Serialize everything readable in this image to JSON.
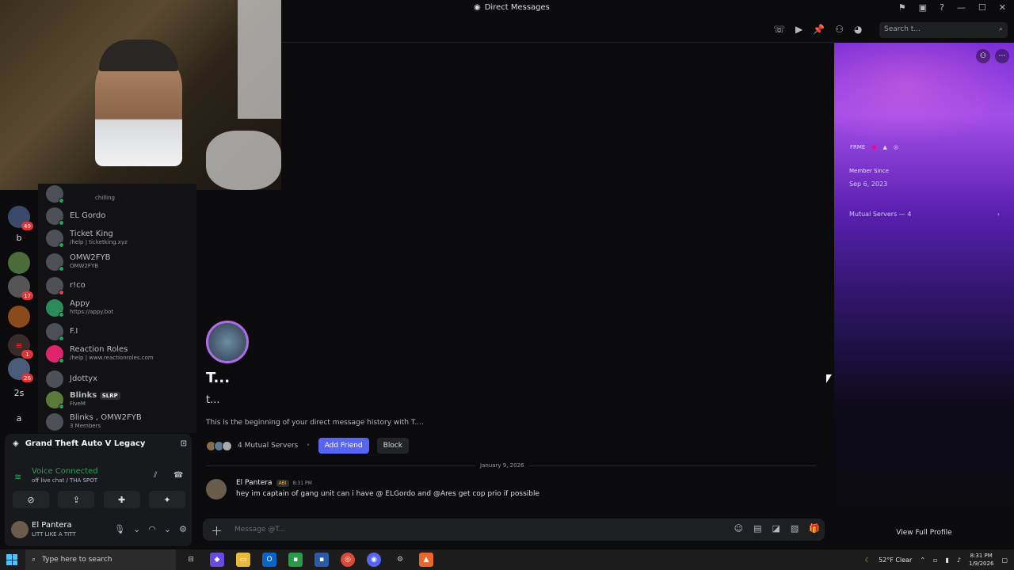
{
  "window": {
    "title": "Direct Messages"
  },
  "header": {
    "search_placeholder": "Search t..."
  },
  "servers": [
    {
      "label": "",
      "badge": "49"
    },
    {
      "label": "b",
      "badge": ""
    },
    {
      "label": "",
      "badge": ""
    },
    {
      "label": "",
      "badge": "17"
    },
    {
      "label": "",
      "badge": ""
    },
    {
      "label": "",
      "badge": "1"
    },
    {
      "label": "",
      "badge": "26"
    },
    {
      "label": "2s",
      "badge": ""
    },
    {
      "label": "a",
      "badge": ""
    }
  ],
  "members": [
    {
      "name": "",
      "sub": "chilling"
    },
    {
      "name": "EL Gordo",
      "sub": ""
    },
    {
      "name": "Ticket King",
      "sub": "/help | ticketking.xyz"
    },
    {
      "name": "OMW2FYB",
      "sub": "OMW2FYB"
    },
    {
      "name": "r!co",
      "sub": ""
    },
    {
      "name": "Appy",
      "sub": "https://appy.bot"
    },
    {
      "name": "F.I",
      "sub": ""
    },
    {
      "name": "Reaction Roles",
      "sub": "/help | www.reactionroles.com"
    },
    {
      "name": "Jdottyx",
      "sub": ""
    },
    {
      "name": "Blinks",
      "sub": "FiveM"
    },
    {
      "name": "Blinks , OMW2FYB",
      "sub": "3 Members"
    }
  ],
  "member_tags": {
    "blinks_tag": "SLRP"
  },
  "voice": {
    "game": "Grand Theft Auto V Legacy",
    "status": "Voice Connected",
    "channel": "off live chat / THA SPOT"
  },
  "user": {
    "name": "El Pantera",
    "status": "LITT LIKE A TITT"
  },
  "dm": {
    "display_name": "T...",
    "username": "t...",
    "beginning": "This is the beginning of your direct message history with T....",
    "mutual_servers": "4 Mutual Servers",
    "add_friend": "Add Friend",
    "block": "Block"
  },
  "messages": {
    "date": "January 9, 2026",
    "items": [
      {
        "author": "El Pantera",
        "tag": "ABI",
        "time": "8:31 PM",
        "text": "hey im captain of gang unit can i have @ ELGordo and @Ares get cop prio if possible"
      }
    ]
  },
  "composer": {
    "placeholder": "Message @T..."
  },
  "profile": {
    "badge_text": "FRME",
    "member_since_label": "Member Since",
    "member_since": "Sep 6, 2023",
    "mutual_servers": "Mutual Servers — 4",
    "view_full": "View Full Profile"
  },
  "taskbar": {
    "search": "Type here to search",
    "weather": "52°F  Clear",
    "time": "8:31 PM",
    "date": "1/9/2026"
  },
  "colors": {
    "accent": "#5865f2",
    "online": "#23a55a",
    "badge": "#da373c"
  }
}
